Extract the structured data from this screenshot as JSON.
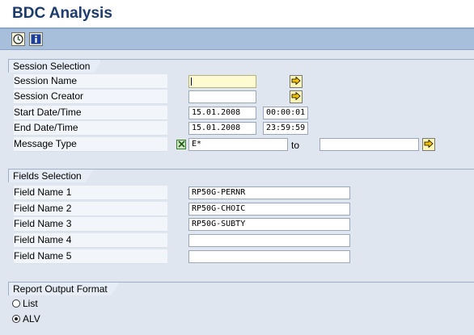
{
  "header": {
    "title": "BDC Analysis"
  },
  "toolbar": {
    "buttons": [
      {
        "icon": "execute-icon"
      },
      {
        "icon": "info-icon"
      }
    ]
  },
  "session_selection": {
    "title": "Session Selection",
    "rows": [
      {
        "label": "Session Name",
        "value": ""
      },
      {
        "label": "Session Creator",
        "value": ""
      },
      {
        "label": "Start Date/Time",
        "date": "15.01.2008",
        "time": "00:00:01"
      },
      {
        "label": "End Date/Time",
        "date": "15.01.2008",
        "time": "23:59:59"
      },
      {
        "label": "Message Type",
        "from": "E*",
        "to_label": "to",
        "to_value": ""
      }
    ]
  },
  "fields_selection": {
    "title": "Fields Selection",
    "rows": [
      {
        "label": "Field Name 1",
        "value": "RP50G-PERNR"
      },
      {
        "label": "Field Name 2",
        "value": "RP50G-CHOIC"
      },
      {
        "label": "Field Name 3",
        "value": "RP50G-SUBTY"
      },
      {
        "label": "Field Name 4",
        "value": ""
      },
      {
        "label": "Field Name 5",
        "value": ""
      }
    ]
  },
  "report_output": {
    "title": "Report Output Format",
    "options": [
      {
        "label": "List",
        "selected": false
      },
      {
        "label": "ALV",
        "selected": true
      }
    ]
  },
  "colors": {
    "title": "#1c3a6b",
    "toolbar": "#a8bfdc",
    "background": "#dfe6ef",
    "required_field": "#fffbd0"
  }
}
